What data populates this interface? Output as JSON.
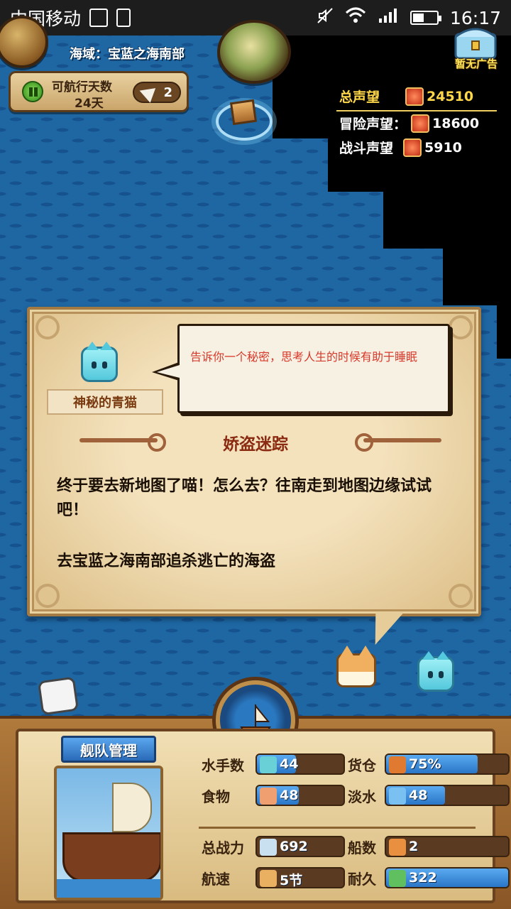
{
  "status_bar": {
    "carrier": "中国移动",
    "time": "16:17",
    "battery_level": 0.45
  },
  "hud": {
    "sea_area_label": "海域：宝蓝之海南部",
    "days_title": "可航行天数",
    "days_value": "24天",
    "compass_count": "2",
    "ad_label": "暂无广告"
  },
  "reputation": {
    "total_label": "总声望",
    "total_value": "24510",
    "adventure_label": "冒险声望：",
    "adventure_value": "18600",
    "combat_label": "战斗声望",
    "combat_value": "5910"
  },
  "dialog": {
    "npc_name": "神秘的青猫",
    "speech": "告诉你一个秘密，思考人生的时候有助于睡眠",
    "quest_title": "娇盗迷踪",
    "quest_body": "终于要去新地图了喵！怎么去？往南走到地图边缘试试吧！",
    "quest_goal": "去宝蓝之海南部追杀逃亡的海盗"
  },
  "fleet": {
    "tab_label": "舰队管理",
    "stats": [
      {
        "label": "水手数",
        "value": "44",
        "fill": 0.45,
        "icon": "sailor-icon"
      },
      {
        "label": "货仓",
        "value": "75%",
        "fill": 0.75,
        "icon": "cargo-icon"
      },
      {
        "label": "食物",
        "value": "48",
        "fill": 0.48,
        "icon": "food-icon"
      },
      {
        "label": "淡水",
        "value": "48",
        "fill": 0.48,
        "icon": "water-icon"
      },
      {
        "label": "总战力",
        "value": "692",
        "fill": 0,
        "icon": "power-icon"
      },
      {
        "label": "船数",
        "value": "2",
        "fill": 0,
        "icon": "ships-icon"
      },
      {
        "label": "航速",
        "value": "5节",
        "fill": 0,
        "icon": "speed-icon"
      },
      {
        "label": "耐久",
        "value": "322",
        "fill": 1.0,
        "icon": "durability-icon"
      }
    ]
  },
  "colors": {
    "ocean": "#1e67a3",
    "accent_gold": "#ffd84a",
    "bar_blue": "#2a76c8",
    "speech_red": "#d8382a",
    "quest_title": "#8a2a10"
  }
}
